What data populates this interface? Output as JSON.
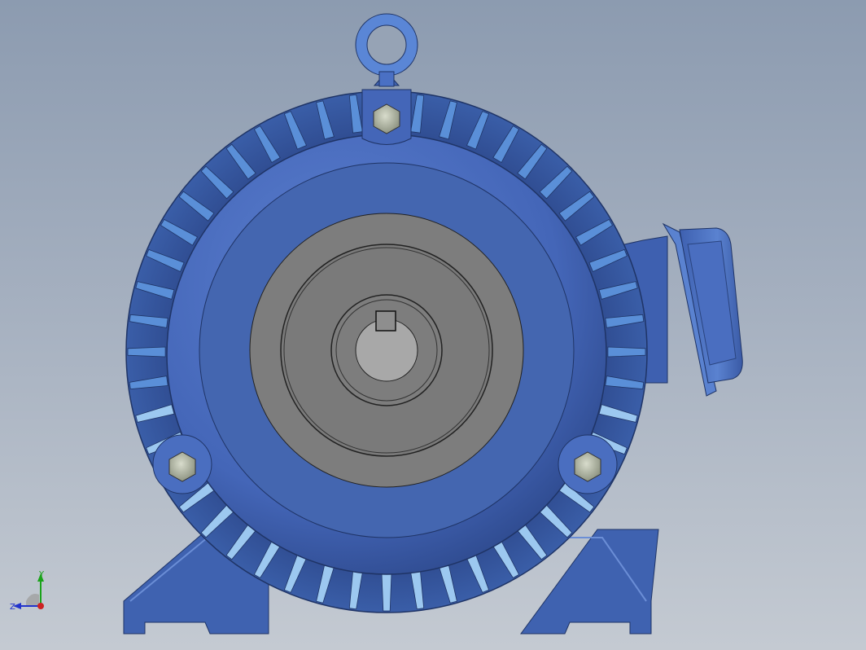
{
  "viewport": {
    "background_top": "#8c9bb0",
    "background_bottom": "#c4cad2"
  },
  "model": {
    "name": "electric-motor-front-view",
    "body_color": "#4466b8",
    "body_dark": "#2e4a8e",
    "fin_color": "#5a8fd8",
    "fin_highlight": "#9cc8f0",
    "face_gray": "#7d7d7d",
    "shaft_gray": "#a8a8a8",
    "fin_count": 48
  },
  "triad": {
    "y_label": "Y",
    "z_label": "Z",
    "y_color": "#1aa31a",
    "z_color": "#2233cc",
    "x_color": "#cc2222"
  }
}
